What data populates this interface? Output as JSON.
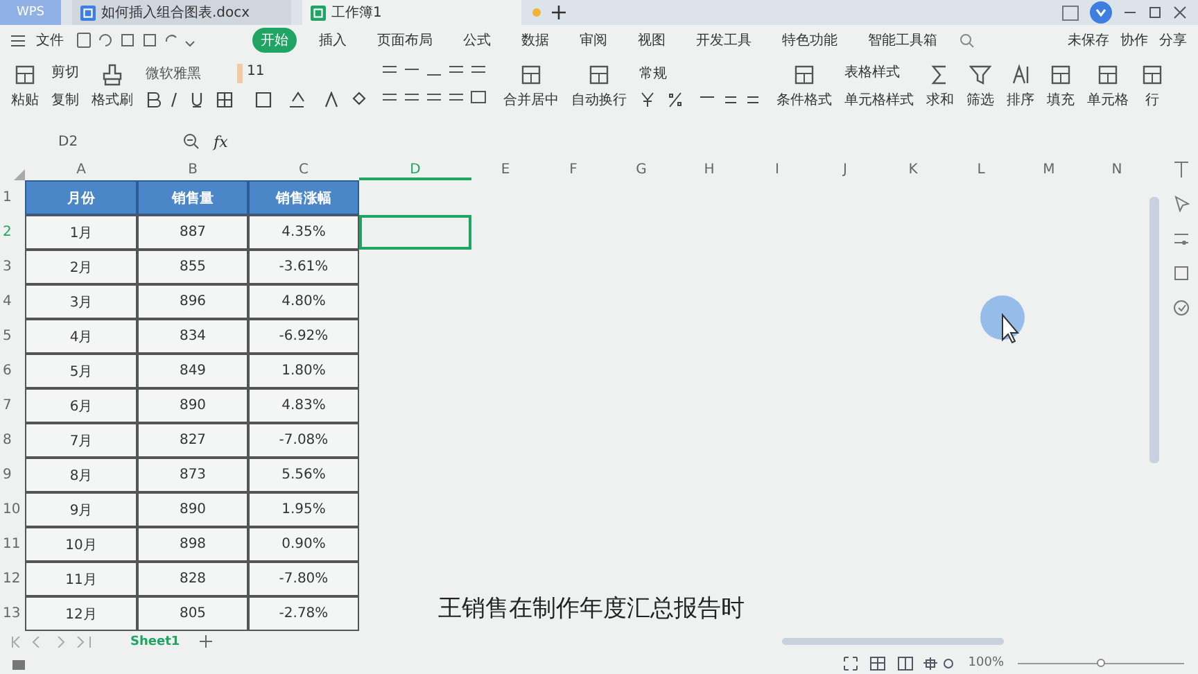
{
  "tabs": [
    {
      "kind": "app",
      "label": "WPS",
      "selected": false
    },
    {
      "kind": "doc",
      "label": "如何插入组合图表.docx",
      "selected": false
    },
    {
      "kind": "sheet",
      "label": "工作簿1",
      "selected": true
    }
  ],
  "menu": {
    "file": "文件",
    "ribbon_tabs": [
      {
        "label": "开始",
        "selected": true
      },
      {
        "label": "插入",
        "selected": false
      },
      {
        "label": "页面布局",
        "selected": false
      },
      {
        "label": "公式",
        "selected": false
      },
      {
        "label": "数据",
        "selected": false
      },
      {
        "label": "审阅",
        "selected": false
      },
      {
        "label": "视图",
        "selected": false
      },
      {
        "label": "开发工具",
        "selected": false
      },
      {
        "label": "特色功能",
        "selected": false
      },
      {
        "label": "智能工具箱",
        "selected": false
      }
    ],
    "actions": [
      "未保存",
      "协作",
      "分享"
    ]
  },
  "ribbon": [
    {
      "kind": "big",
      "label": "粘贴"
    },
    {
      "kind": "pair",
      "labels": [
        "剪切",
        "复制"
      ]
    },
    {
      "kind": "big",
      "label": "格式刷"
    },
    {
      "kind": "font",
      "font": "微软雅黑",
      "size": "11"
    },
    {
      "kind": "align"
    },
    {
      "kind": "big",
      "label": "合并居中"
    },
    {
      "kind": "big",
      "label": "自动换行"
    },
    {
      "kind": "number",
      "format": "常规"
    },
    {
      "kind": "big",
      "label": "条件格式"
    },
    {
      "kind": "pair",
      "labels": [
        "表格样式",
        "单元格样式"
      ]
    },
    {
      "kind": "big",
      "label": "求和"
    },
    {
      "kind": "big",
      "label": "筛选"
    },
    {
      "kind": "big",
      "label": "排序"
    },
    {
      "kind": "big",
      "label": "填充"
    },
    {
      "kind": "big",
      "label": "单元格"
    },
    {
      "kind": "big",
      "label": "行"
    }
  ],
  "formula_bar": {
    "name_box": "D2",
    "fx": "fx"
  },
  "columns": [
    {
      "label": "A",
      "selected": false
    },
    {
      "label": "B",
      "selected": false
    },
    {
      "label": "C",
      "selected": false
    },
    {
      "label": "D",
      "selected": true
    },
    {
      "label": "E",
      "selected": false
    },
    {
      "label": "F",
      "selected": false
    },
    {
      "label": "G",
      "selected": false
    },
    {
      "label": "H",
      "selected": false
    },
    {
      "label": "I",
      "selected": false
    },
    {
      "label": "J",
      "selected": false
    },
    {
      "label": "K",
      "selected": false
    },
    {
      "label": "L",
      "selected": false
    },
    {
      "label": "M",
      "selected": false
    },
    {
      "label": "N",
      "selected": false
    }
  ],
  "table": {
    "header": [
      "月份",
      "销售量",
      "销售涨幅"
    ],
    "rows": [
      {
        "number": "1",
        "selected": false
      },
      {
        "number": "2",
        "selected": true,
        "cells": [
          "1月",
          "887",
          "4.35%"
        ]
      },
      {
        "number": "3",
        "selected": false,
        "cells": [
          "2月",
          "855",
          "-3.61%"
        ]
      },
      {
        "number": "4",
        "selected": false,
        "cells": [
          "3月",
          "896",
          "4.80%"
        ]
      },
      {
        "number": "5",
        "selected": false,
        "cells": [
          "4月",
          "834",
          "-6.92%"
        ]
      },
      {
        "number": "6",
        "selected": false,
        "cells": [
          "5月",
          "849",
          "1.80%"
        ]
      },
      {
        "number": "7",
        "selected": false,
        "cells": [
          "6月",
          "890",
          "4.83%"
        ]
      },
      {
        "number": "8",
        "selected": false,
        "cells": [
          "7月",
          "827",
          "-7.08%"
        ]
      },
      {
        "number": "9",
        "selected": false,
        "cells": [
          "8月",
          "873",
          "5.56%"
        ]
      },
      {
        "number": "10",
        "selected": false,
        "cells": [
          "9月",
          "890",
          "1.95%"
        ]
      },
      {
        "number": "11",
        "selected": false,
        "cells": [
          "10月",
          "898",
          "0.90%"
        ]
      },
      {
        "number": "12",
        "selected": false,
        "cells": [
          "11月",
          "828",
          "-7.80%"
        ]
      },
      {
        "number": "13",
        "selected": false,
        "cells": [
          "12月",
          "805",
          "-2.78%"
        ]
      }
    ]
  },
  "sheets": [
    {
      "label": "Sheet1",
      "selected": true
    }
  ],
  "subtitle": "王销售在制作年度汇总报告时",
  "status": {
    "zoom": "100%",
    "level": 0.5
  }
}
